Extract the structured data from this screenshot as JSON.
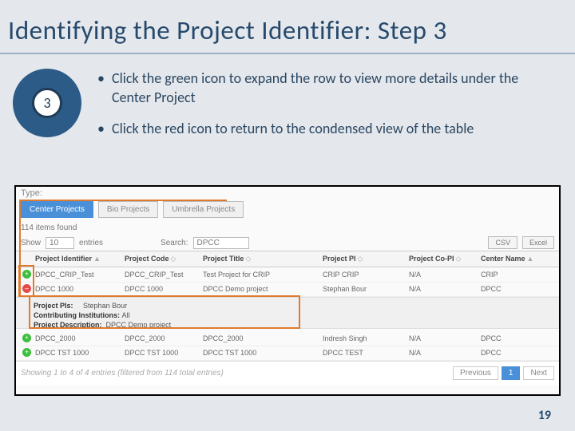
{
  "title": "Identifying the Project Identifier: Step 3",
  "badge": "3",
  "bullets": [
    "Click the green icon to expand the row to view more details under the Center Project",
    "Click the red icon to return to the condensed view of the table"
  ],
  "ui": {
    "type_label": "Type:",
    "tabs": [
      "Center Projects",
      "Bio Projects",
      "Umbrella Projects"
    ],
    "found": "114 items found",
    "show_label": "Show",
    "show_value": "10",
    "entries_label": "entries",
    "search_label": "Search:",
    "search_value": "DPCC",
    "export_csv": "CSV",
    "export_excel": "Excel",
    "columns": [
      "Project Identifier",
      "Project Code",
      "Project Title",
      "Project PI",
      "Project Co-PI",
      "Center Name"
    ],
    "rows": [
      {
        "exp": "green",
        "id": "DPCC_CRIP_Test",
        "code": "DPCC_CRIP_Test",
        "title": "Test Project for CRIP",
        "pi": "CRIP CRIP",
        "copi": "N/A",
        "center": "CRIP"
      },
      {
        "exp": "red",
        "id": "DPCC 1000",
        "code": "DPCC 1000",
        "title": "DPCC Demo project",
        "pi": "Stephan Bour",
        "copi": "N/A",
        "center": "DPCC"
      },
      {
        "exp": "green",
        "id": "DPCC_2000",
        "code": "DPCC_2000",
        "title": "DPCC_2000",
        "pi": "Indresh Singh",
        "copi": "N/A",
        "center": "DPCC"
      },
      {
        "exp": "green",
        "id": "DPCC TST 1000",
        "code": "DPCC TST 1000",
        "title": "DPCC TST 1000",
        "pi": "DPCC TEST",
        "copi": "N/A",
        "center": "DPCC"
      }
    ],
    "detail": {
      "pis_label": "Project PIs:",
      "pis_value": "Stephan Bour",
      "inst_label": "Contributing Institutions:",
      "inst_value": "All",
      "desc_label": "Project Description:",
      "desc_value": "DPCC Demo project"
    },
    "footer_info": "Showing 1 to 4 of 4 entries (filtered from 114 total entries)",
    "pager": {
      "prev": "Previous",
      "page": "1",
      "next": "Next"
    }
  },
  "page_number": "19"
}
